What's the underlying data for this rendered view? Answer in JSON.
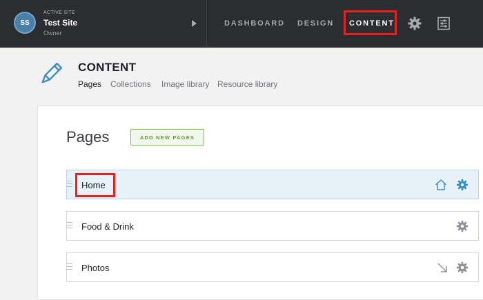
{
  "site": {
    "avatar_initials": "SS",
    "kicker": "ACTIVE SITE",
    "name": "Test Site",
    "role": "Owner"
  },
  "nav": {
    "items": [
      {
        "label": "DASHBOARD"
      },
      {
        "label": "DESIGN"
      },
      {
        "label": "CONTENT",
        "active": true
      }
    ],
    "icons": [
      "gear-icon",
      "sliders-icon"
    ]
  },
  "section": {
    "title": "CONTENT",
    "icon": "pencil-icon",
    "subnav": [
      {
        "label": "Pages",
        "active": true
      },
      {
        "label": "Collections"
      },
      {
        "label": "Image library"
      },
      {
        "label": "Resource library"
      }
    ]
  },
  "pages_panel": {
    "heading": "Pages",
    "add_button": "ADD NEW PAGES",
    "rows": [
      {
        "label": "Home",
        "selected": true,
        "icons": [
          "home-icon",
          "gear-icon"
        ]
      },
      {
        "label": "Food & Drink",
        "icons": [
          "gear-icon"
        ]
      },
      {
        "label": "Photos",
        "icons": [
          "arrow-down-right-icon",
          "gear-icon"
        ]
      }
    ]
  },
  "colors": {
    "topbar": "#2b2d30",
    "accent_blue": "#3b8ec2",
    "highlight_red": "#e8201f",
    "button_green": "#5d9c37",
    "selected_row": "#e6f1f8"
  }
}
